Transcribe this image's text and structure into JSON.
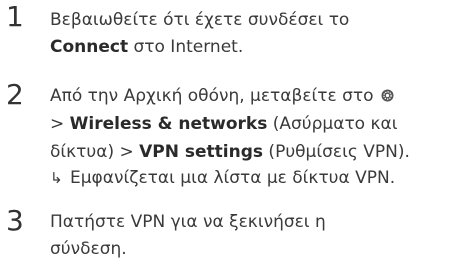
{
  "steps": [
    {
      "number": "1",
      "line1": "Βεβαιωθείτε ότι έχετε συνδέσει το",
      "line2_bold": "Connect",
      "line2_rest": " στο Internet."
    },
    {
      "number": "2",
      "line1": "Από την Αρχική οθόνη, μεταβείτε στο",
      "line2_prefix": "> ",
      "line2_bold": "Wireless & networks",
      "line2_rest": " (Ασύρματο και",
      "line3_prefix": "δίκτυα) > ",
      "line3_bold": "VPN settings",
      "line3_rest": " (Ρυθμίσεις VPN).",
      "result_arrow": "↳",
      "result_text": "Εμφανίζεται μια λίστα με δίκτυα VPN."
    },
    {
      "number": "3",
      "line1": "Πατήστε VPN για να ξεκινήσει η",
      "line2": "σύνδεση."
    }
  ],
  "icons": {
    "settings_icon": "gear-icon",
    "settings_icon_color": "#555555"
  }
}
